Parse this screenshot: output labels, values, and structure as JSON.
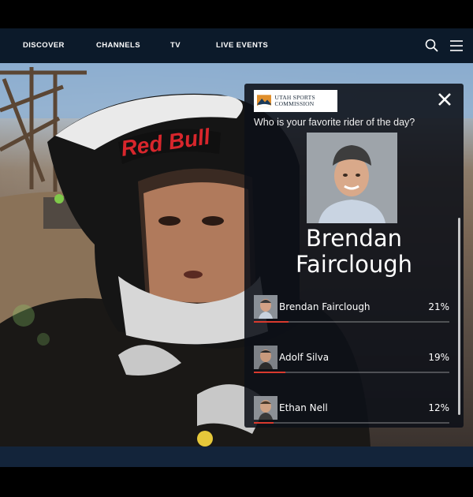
{
  "nav": {
    "items": [
      {
        "label": "DISCOVER"
      },
      {
        "label": "CHANNELS"
      },
      {
        "label": "TV"
      },
      {
        "label": "LIVE EVENTS"
      }
    ],
    "search_icon": "search-icon",
    "menu_icon": "hamburger-menu-icon"
  },
  "video": {
    "helmet_text": "Red Bull"
  },
  "poll": {
    "logo_text": "UTAH SPORTS COMMISSION",
    "question": "Who is your favorite rider of the day?",
    "featured_rider": "Brendan Fairclough",
    "options": [
      {
        "name": "Brendan Fairclough",
        "percent_label": "21%",
        "percent": 21
      },
      {
        "name": "Adolf Silva",
        "percent_label": "19%",
        "percent": 19
      },
      {
        "name": "Ethan Nell",
        "percent_label": "12%",
        "percent": 12
      }
    ],
    "accent_color": "#d83a2e"
  }
}
